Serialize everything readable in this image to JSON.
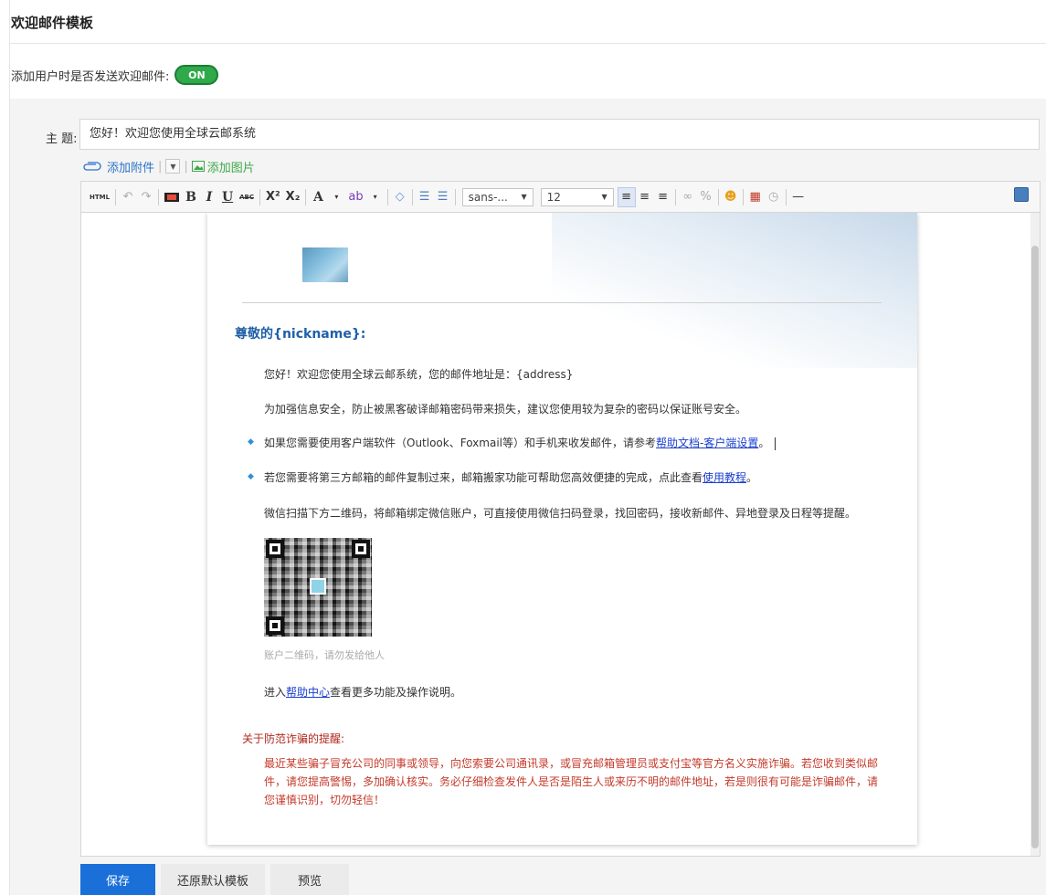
{
  "header": {
    "title": "欢迎邮件模板"
  },
  "welcome_toggle": {
    "label": "添加用户时是否发送欢迎邮件:",
    "state": "ON",
    "color": "#2fa94a"
  },
  "subject": {
    "label": "主 题:",
    "value": "您好！欢迎您使用全球云邮系统"
  },
  "attach": {
    "add_attachment": "添加附件",
    "add_image": "添加图片"
  },
  "toolbar": {
    "html": "HTML",
    "bold": "B",
    "italic": "I",
    "underline": "U",
    "strike": "ABC",
    "superscript": "X²",
    "subscript": "X₂",
    "font_color": "A",
    "font_family": "sans-...",
    "font_size": "12"
  },
  "email": {
    "greeting": "尊敬的{nickname}:",
    "line1": "您好！欢迎您使用全球云邮系统，您的邮件地址是：{address}",
    "line2": "为加强信息安全，防止被黑客破译邮箱密码带来损失，建议您使用较为复杂的密码以保证账号安全。",
    "bullet1_text": "如果您需要使用客户端软件（Outlook、Foxmail等）和手机来收发邮件，请参考",
    "bullet1_link": "帮助文档-客户端设置",
    "bullet1_end": "。",
    "bullet2_text": "若您需要将第三方邮箱的邮件复制过来，邮箱搬家功能可帮助您高效便捷的完成，点此查看",
    "bullet2_link": "使用教程",
    "bullet2_end": "。",
    "wechat": "微信扫描下方二维码，将邮箱绑定微信账户，可直接使用微信扫码登录，找回密码，接收新邮件、异地登录及日程等提醒。",
    "qr_caption": "账户二维码，请勿发给他人",
    "help_prefix": "进入",
    "help_link": "帮助中心",
    "help_suffix": "查看更多功能及操作说明。",
    "warn_title": "关于防范诈骗的提醒:",
    "warn_body": "最近某些骗子冒充公司的同事或领导，向您索要公司通讯录，或冒充邮箱管理员或支付宝等官方名义实施诈骗。若您收到类似邮件，请您提高警惕，多加确认核实。务必仔细检查发件人是否是陌生人或来历不明的邮件地址，若是则很有可能是诈骗邮件，请您谨慎识别，切勿轻信！"
  },
  "actions": {
    "save": "保存",
    "restore": "还原默认模板",
    "preview": "预览"
  },
  "colors": {
    "primary": "#1b6fd8",
    "link": "#1a3fcf",
    "warning": "#c43a2b",
    "greeting": "#1f5fa8"
  }
}
